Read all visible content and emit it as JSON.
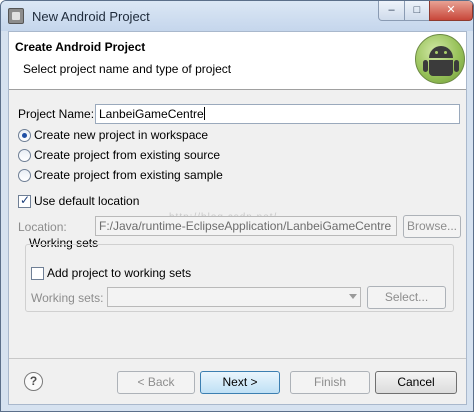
{
  "window": {
    "title": "New Android Project",
    "minimize": "–",
    "maximize": "□",
    "close": "✕"
  },
  "header": {
    "title": "Create Android Project",
    "subtitle": "Select project name and type of project",
    "logo_icon": "android-logo-icon"
  },
  "form": {
    "project_name_label": "Project Name:",
    "project_name_value": "LanbeiGameCentre",
    "radio_options": [
      {
        "label": "Create new project in workspace",
        "selected": true
      },
      {
        "label": "Create project from existing source",
        "selected": false
      },
      {
        "label": "Create project from existing sample",
        "selected": false
      }
    ],
    "use_default_location_label": "Use default location",
    "use_default_location_checked": true,
    "location_label": "Location:",
    "location_value": "F:/Java/runtime-EclipseApplication/LanbeiGameCentre",
    "browse_label": "Browse..."
  },
  "working_sets": {
    "group_label": "Working sets",
    "add_label": "Add project to working sets",
    "add_checked": false,
    "sets_label": "Working sets:",
    "sets_value": "",
    "select_label": "Select..."
  },
  "footer": {
    "help_icon": "help-icon",
    "help_glyph": "?",
    "back_label": "< Back",
    "next_label": "Next >",
    "finish_label": "Finish",
    "cancel_label": "Cancel"
  },
  "watermark": "http://blog.csdn.net/"
}
